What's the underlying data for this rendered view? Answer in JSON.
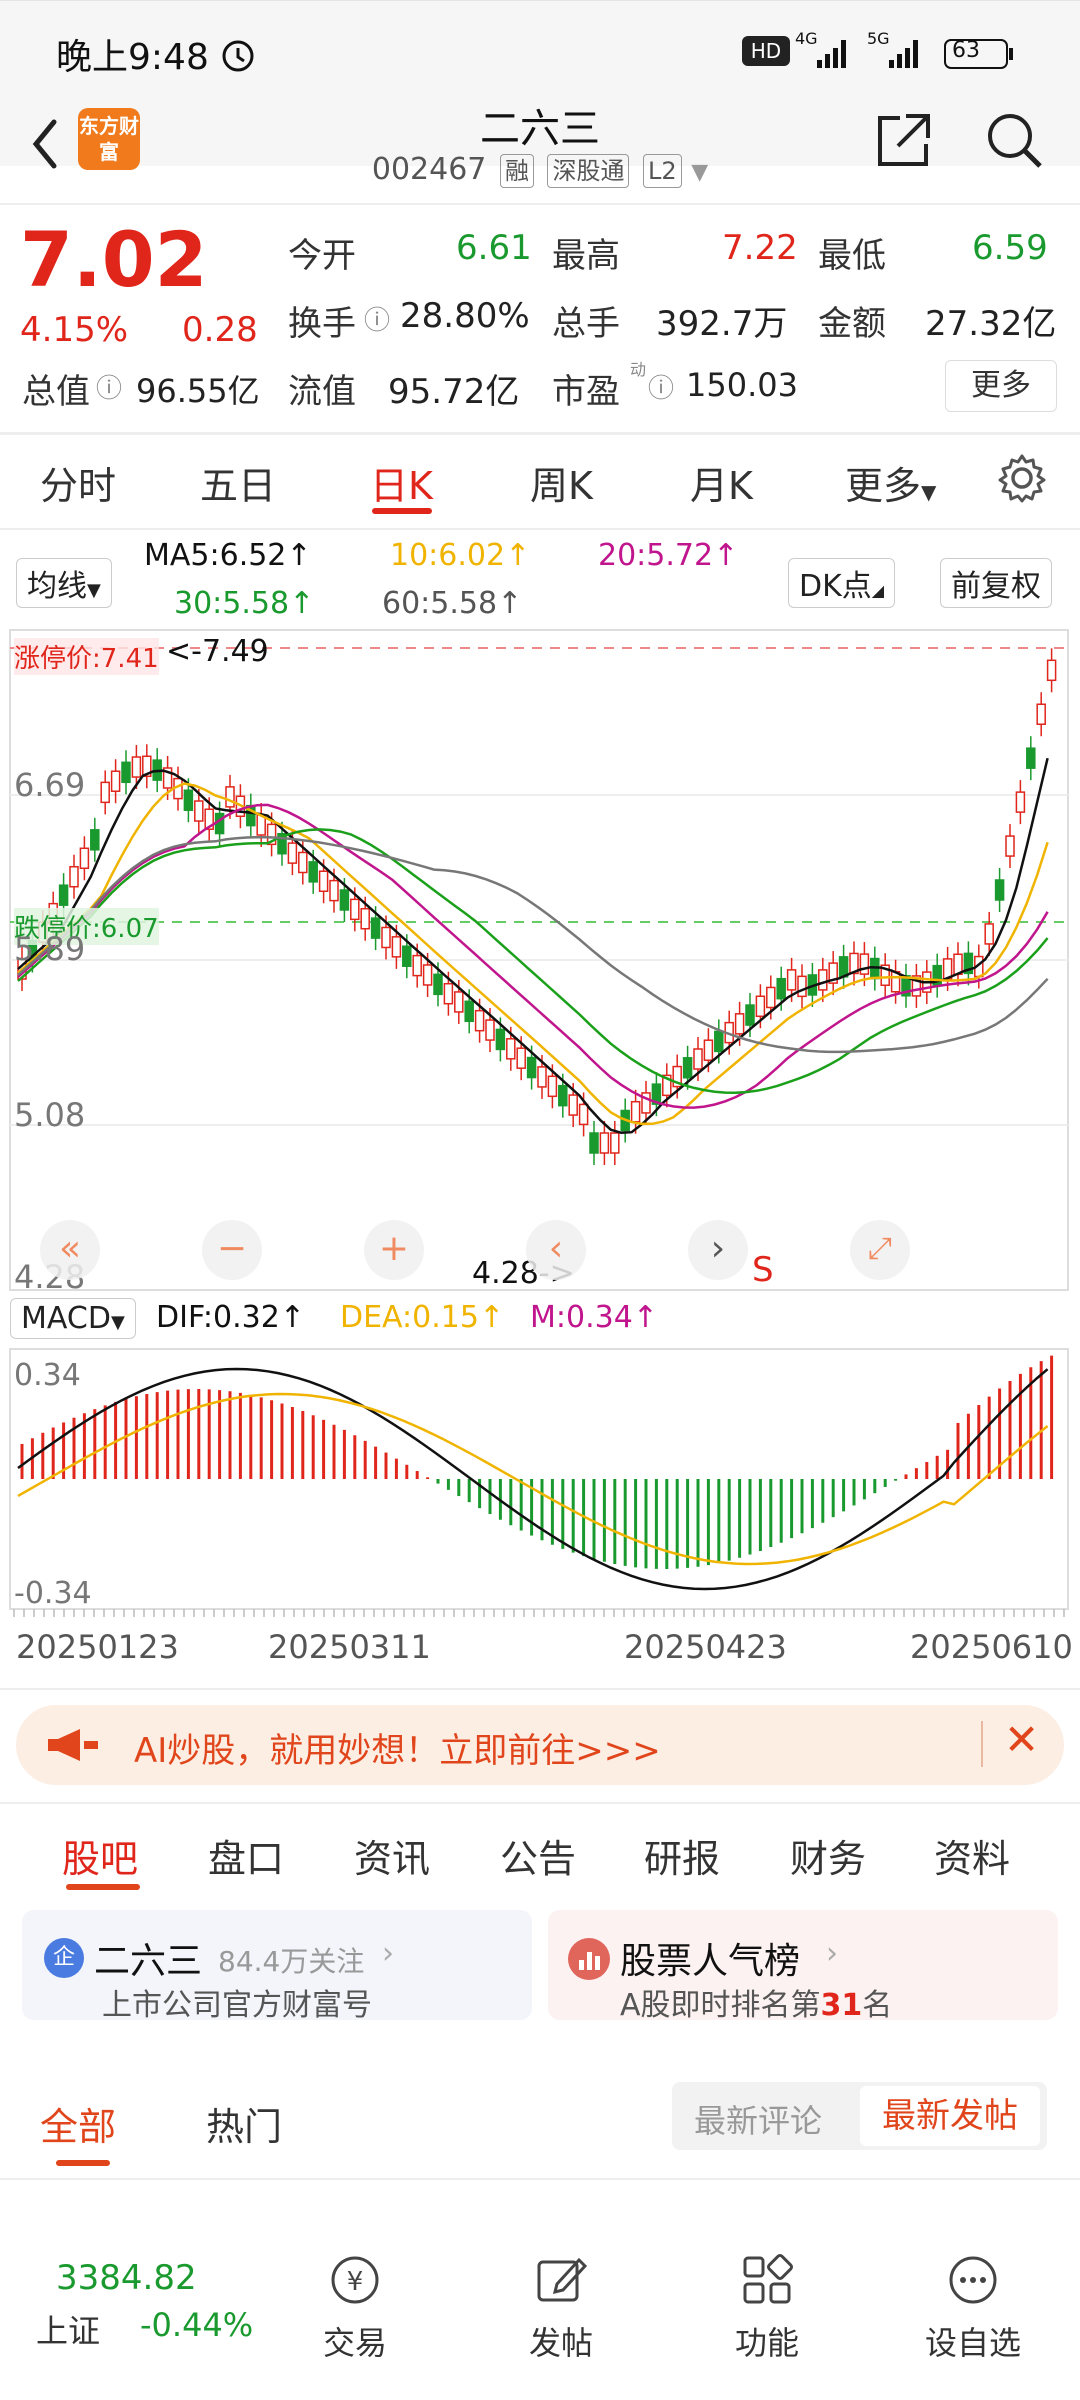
{
  "status": {
    "time": "晚上9:48",
    "battery": "63",
    "signal1": "4G",
    "signal2": "5G",
    "hd": "HD"
  },
  "header": {
    "name": "二六三",
    "code": "002467",
    "tags": [
      "融",
      "深股通",
      "L2"
    ],
    "logo_text": "东方财富"
  },
  "quote": {
    "price": "7.02",
    "pct": "4.15%",
    "chg": "0.28",
    "open_label": "今开",
    "open": "6.61",
    "high_label": "最高",
    "high": "7.22",
    "low_label": "最低",
    "low": "6.59",
    "turnover_label": "换手",
    "turnover": "28.80%",
    "volume_label": "总手",
    "volume": "392.7万",
    "amount_label": "金额",
    "amount": "27.32亿",
    "mcap_label": "总值",
    "mcap": "96.55亿",
    "float_label": "流值",
    "float": "95.72亿",
    "pe_label": "市盈",
    "pe": "150.03",
    "pe_sup": "动",
    "more": "更多"
  },
  "kline_tabs": [
    "分时",
    "五日",
    "日K",
    "周K",
    "月K",
    "更多"
  ],
  "legend": {
    "ma_select": "均线",
    "ma5": "MA5:6.52",
    "ma10": "10:6.02",
    "ma20": "20:5.72",
    "ma30": "30:5.58",
    "ma60": "60:5.58",
    "dk": "DK点",
    "fq": "前复权"
  },
  "chart": {
    "limit_up": "涨停价:7.41",
    "limit_up_arrow": "<-7.49",
    "limit_down": "跌停价:6.07",
    "y_labels": [
      "6.69",
      "5.89",
      "5.08",
      "4.28"
    ],
    "low_marker": "4.28->",
    "s_marker": "S",
    "macd_select": "MACD",
    "dif": "DIF:0.32",
    "dea": "DEA:0.15",
    "m": "M:0.34",
    "macd_top": "0.34",
    "macd_bottom": "-0.34",
    "dates": [
      "20250123",
      "20250311",
      "20250423",
      "20250610"
    ],
    "colors": {
      "up": "#e0251b",
      "down": "#1a9a2e",
      "ma5": "#111111",
      "ma10": "#f0b400",
      "ma20": "#c0158c",
      "ma30": "#1aa01a",
      "ma60": "#777777"
    }
  },
  "banner": {
    "text": "AI炒股，就用妙想！立即前往>>>"
  },
  "bottom_tabs": [
    "股吧",
    "盘口",
    "资讯",
    "公告",
    "研报",
    "财务",
    "资料"
  ],
  "cards": {
    "left": {
      "badge": "企",
      "name": "二六三",
      "follow": "84.4万关注",
      "sub": "上市公司官方财富号"
    },
    "right": {
      "title": "股票人气榜",
      "sub_prefix": "A股即时排名第",
      "rank": "31",
      "sub_suffix": "名"
    }
  },
  "post_tabs": {
    "all": "全部",
    "hot": "热门",
    "latest_comment": "最新评论",
    "latest_post": "最新发帖"
  },
  "footer": {
    "index_value": "3384.82",
    "index_name": "上证",
    "index_chg": "-0.44%",
    "items": [
      "交易",
      "发帖",
      "功能",
      "设自选"
    ]
  }
}
